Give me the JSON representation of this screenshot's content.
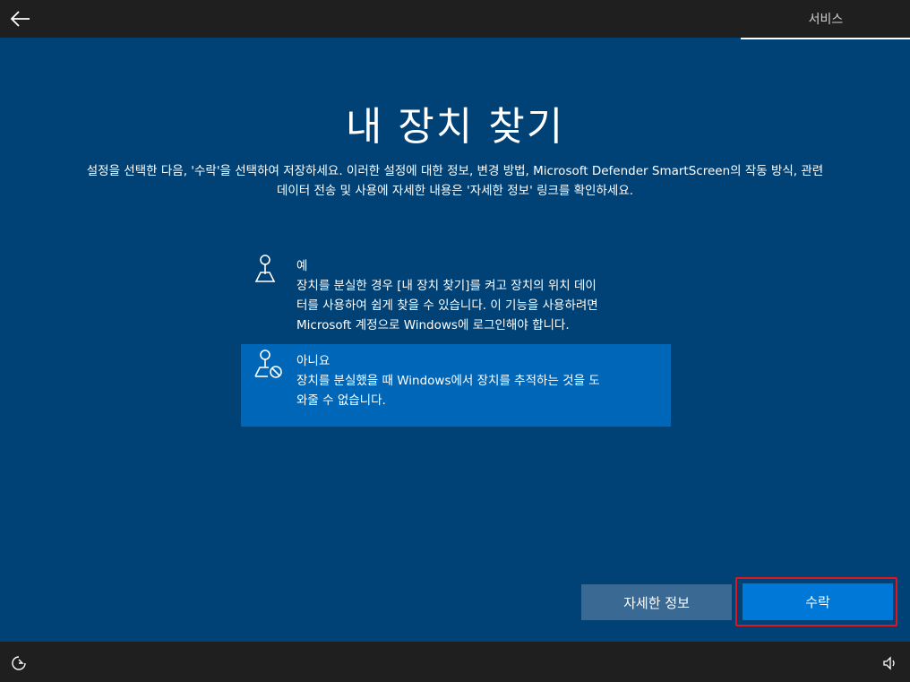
{
  "header": {
    "back_icon": "back-arrow-icon",
    "tab_label": "서비스"
  },
  "main": {
    "title": "내 장치 찾기",
    "intro_line1": "설정을 선택한 다음, '수락'을 선택하여 저장하세요. 이러한 설정에 대한 정보, 변경 방법, Microsoft Defender SmartScreen의 작동 방식, 관련",
    "intro_line2": "데이터 전송 및 사용에 자세한 내용은 '자세한 정보' 링크를 확인하세요."
  },
  "options": [
    {
      "icon": "location-pin-map-icon",
      "title": "예",
      "desc_lines": [
        "장치를 분실한 경우 [내 장치 찾기]를 켜고 장치의 위치 데이",
        "터를 사용하여 쉽게 찾을 수 있습니다. 이 기능을 사용하려면",
        "Microsoft 계정으로 Windows에 로그인해야 합니다."
      ],
      "selected": false
    },
    {
      "icon": "location-pin-blocked-icon",
      "title": "아니요",
      "desc_lines": [
        "장치를 분실했을 때 Windows에서 장치를 추적하는 것을 도",
        "와줄 수 없습니다."
      ],
      "selected": true
    }
  ],
  "buttons": {
    "more_info": "자세한 정보",
    "accept": "수락"
  },
  "footer": {
    "ease_icon": "ease-of-access-icon",
    "volume_icon": "volume-icon"
  },
  "colors": {
    "background": "#004275",
    "selected_option": "#0067b8",
    "accept_button": "#0078d7",
    "more_info_button": "#3a6a94",
    "highlight_outline": "#e0161f",
    "bars": "#1f1f1f"
  }
}
